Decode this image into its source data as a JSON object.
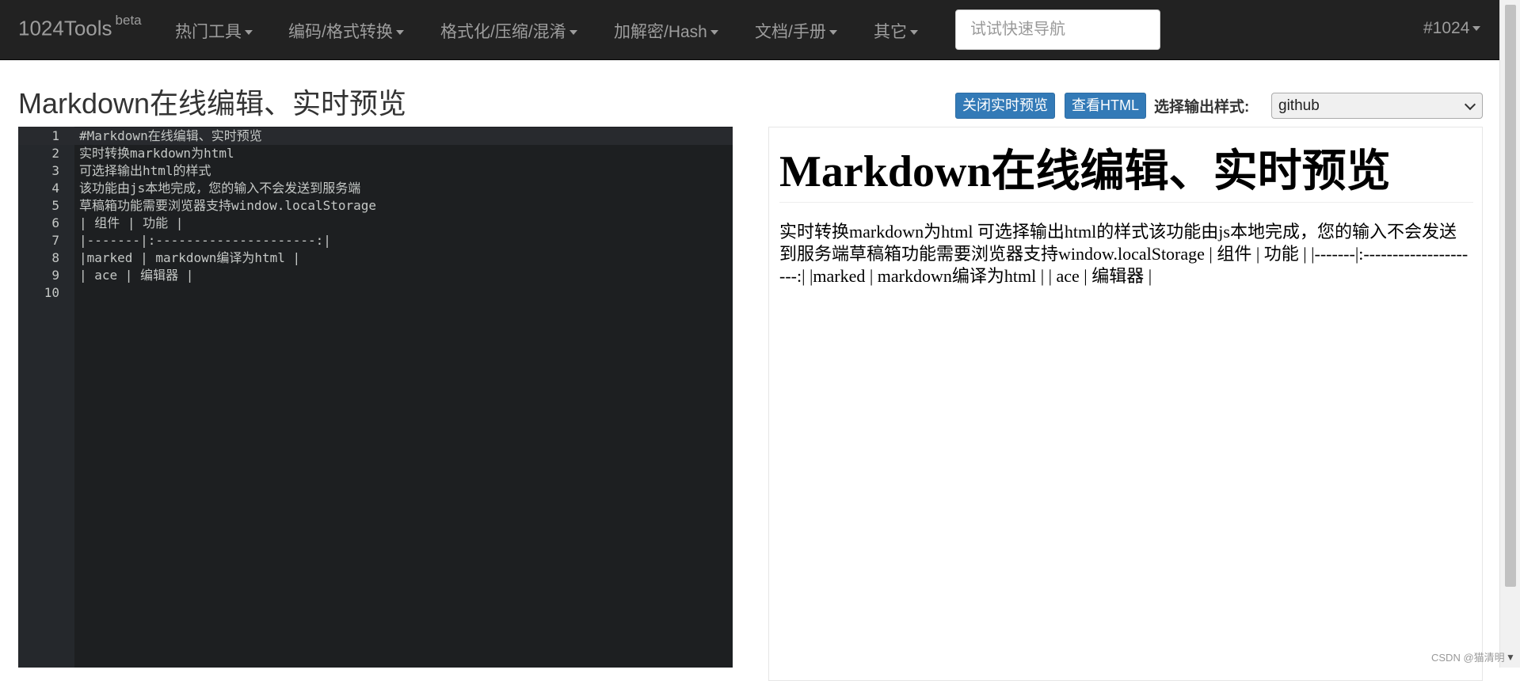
{
  "nav": {
    "brand": "1024Tools",
    "brand_sup": "beta",
    "items": [
      {
        "label": "热门工具"
      },
      {
        "label": "编码/格式转换"
      },
      {
        "label": "格式化/压缩/混淆"
      },
      {
        "label": "加解密/Hash"
      },
      {
        "label": "文档/手册"
      },
      {
        "label": "其它"
      }
    ],
    "search_placeholder": "试试快速导航",
    "right_item": "#1024"
  },
  "page": {
    "title": "Markdown在线编辑、实时预览"
  },
  "toolbar": {
    "close_preview_label": "关闭实时预览",
    "view_html_label": "查看HTML",
    "style_label": "选择输出样式:",
    "style_selected": "github"
  },
  "editor": {
    "lines": [
      {
        "num": "1",
        "text": "#Markdown在线编辑、实时预览"
      },
      {
        "num": "2",
        "text": "实时转换markdown为html"
      },
      {
        "num": "3",
        "text": "可选择输出html的样式"
      },
      {
        "num": "4",
        "text": "该功能由js本地完成，您的输入不会发送到服务端"
      },
      {
        "num": "5",
        "text": "草稿箱功能需要浏览器支持window.localStorage"
      },
      {
        "num": "6",
        "text": "| 组件 | 功能 |"
      },
      {
        "num": "7",
        "text": "|-------|:---------------------:|"
      },
      {
        "num": "8",
        "text": "|marked | markdown编译为html |"
      },
      {
        "num": "9",
        "text": "| ace | 编辑器 |"
      },
      {
        "num": "10",
        "text": ""
      }
    ]
  },
  "preview": {
    "heading": "Markdown在线编辑、实时预览",
    "paragraph": "实时转换markdown为html 可选择输出html的样式该功能由js本地完成，您的输入不会发送到服务端草稿箱功能需要浏览器支持window.localStorage | 组件 | 功能 | |-------|:---------------------:| |marked | markdown编译为html | | ace | 编辑器 |"
  },
  "watermark": "CSDN @猫清明",
  "colors": {
    "navbar_bg": "#222222",
    "nav_text": "#9d9d9d",
    "button_blue": "#337ab7",
    "editor_bg": "#1d1f21",
    "editor_gutter": "#25282c",
    "editor_text": "#c5c8c6"
  }
}
